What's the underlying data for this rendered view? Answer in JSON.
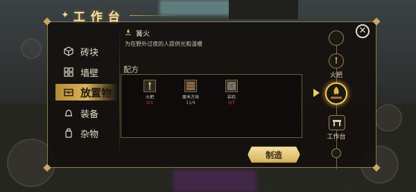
{
  "window": {
    "title": "工作台"
  },
  "categories": [
    {
      "label": "砖块",
      "icon": "cube-icon",
      "active": false
    },
    {
      "label": "墙壁",
      "icon": "wall-grid-icon",
      "active": false
    },
    {
      "label": "放置物",
      "icon": "chest-icon",
      "active": true
    },
    {
      "label": "装备",
      "icon": "bell-icon",
      "active": false
    },
    {
      "label": "杂物",
      "icon": "jar-icon",
      "active": false
    }
  ],
  "item": {
    "name": "篝火",
    "icon": "campfire-icon",
    "description": "为在野外过夜的人提供光和温暖"
  },
  "recipe": {
    "label": "配方",
    "ingredients": [
      {
        "name": "火把",
        "count": "0/1",
        "status": "insufficient",
        "icon": "torch-icon"
      },
      {
        "name": "原木方块",
        "count": "11/4",
        "status": "sufficient",
        "icon": "log-block-icon"
      },
      {
        "name": "岩石",
        "count": "0/7",
        "status": "insufficient",
        "icon": "rock-icon"
      }
    ]
  },
  "actions": {
    "craft_label": "制造"
  },
  "rail": {
    "items": [
      {
        "label": "火把",
        "icon": "torch-icon",
        "selected": false
      },
      {
        "label": "",
        "icon": "campfire-icon",
        "selected": true
      },
      {
        "label": "工作台",
        "icon": "workbench-icon",
        "selected": false
      }
    ]
  },
  "colors": {
    "accent_gold": "#d9b25e",
    "insufficient_red": "#e0423a",
    "sufficient_green": "#6cd36a"
  }
}
